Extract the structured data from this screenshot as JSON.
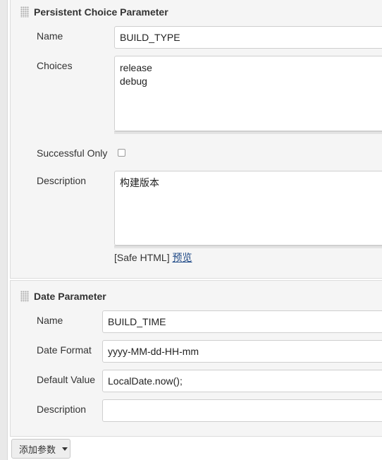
{
  "persistent_choice": {
    "title": "Persistent Choice Parameter",
    "name_label": "Name",
    "name_value": "BUILD_TYPE",
    "choices_label": "Choices",
    "choices": [
      "release",
      "debug"
    ],
    "successful_only_label": "Successful Only",
    "successful_only_checked": false,
    "description_label": "Description",
    "description_value": "构建版本",
    "safe_html_text": "[Safe HTML]",
    "preview_link": "预览"
  },
  "date_parameter": {
    "title": "Date Parameter",
    "name_label": "Name",
    "name_value": "BUILD_TIME",
    "date_format_label": "Date Format",
    "date_format_value": "yyyy-MM-dd-HH-mm",
    "default_value_label": "Default Value",
    "default_value_value": "LocalDate.now();",
    "description_label": "Description",
    "description_value": ""
  },
  "add_parameter_button": "添加参数"
}
